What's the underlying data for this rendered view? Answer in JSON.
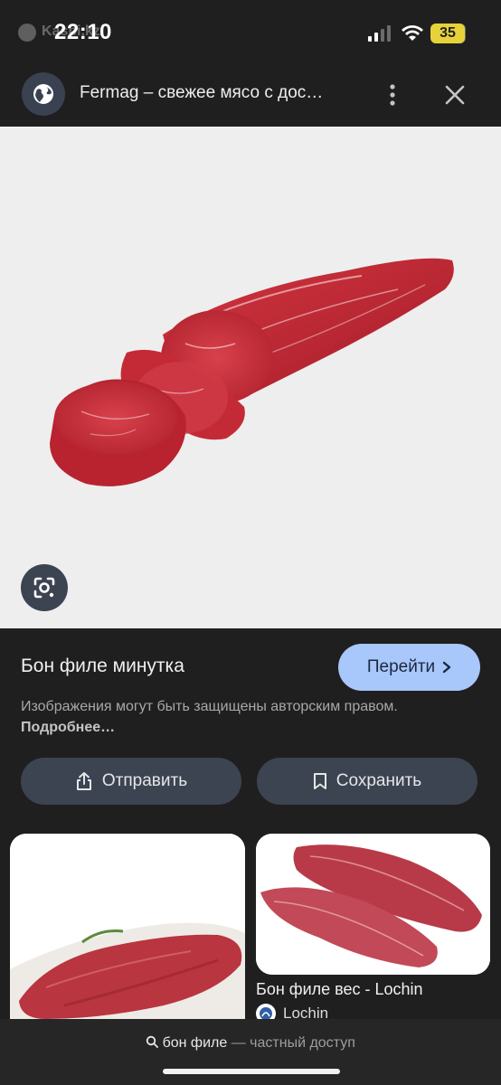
{
  "status_bar": {
    "time": "22:10",
    "carrier_hint": "Kaspi.kz",
    "battery": "35"
  },
  "header": {
    "title": "Fermag – свежее мясо с дос…"
  },
  "result": {
    "title": "Бон филе минутка",
    "goto_label": "Перейти",
    "copyright_text": "Изображения могут быть защищены авторским правом.",
    "learn_more": "Подробнее…",
    "share_label": "Отправить",
    "save_label": "Сохранить"
  },
  "related": [
    {
      "title": "",
      "source": ""
    },
    {
      "title": "Бон филе вес - Lochin",
      "source": "Lochin"
    }
  ],
  "bottom_bar": {
    "query": "бон филе",
    "mode": "— частный доступ"
  },
  "colors": {
    "background": "#1f1f1f",
    "accent_button": "#a8c7fa",
    "secondary_button": "#3c4452",
    "battery": "#e7d23a"
  },
  "icons": [
    "globe-icon",
    "more-vert-icon",
    "close-icon",
    "lens-icon",
    "share-icon",
    "bookmark-icon",
    "chevron-right-icon",
    "search-icon"
  ]
}
